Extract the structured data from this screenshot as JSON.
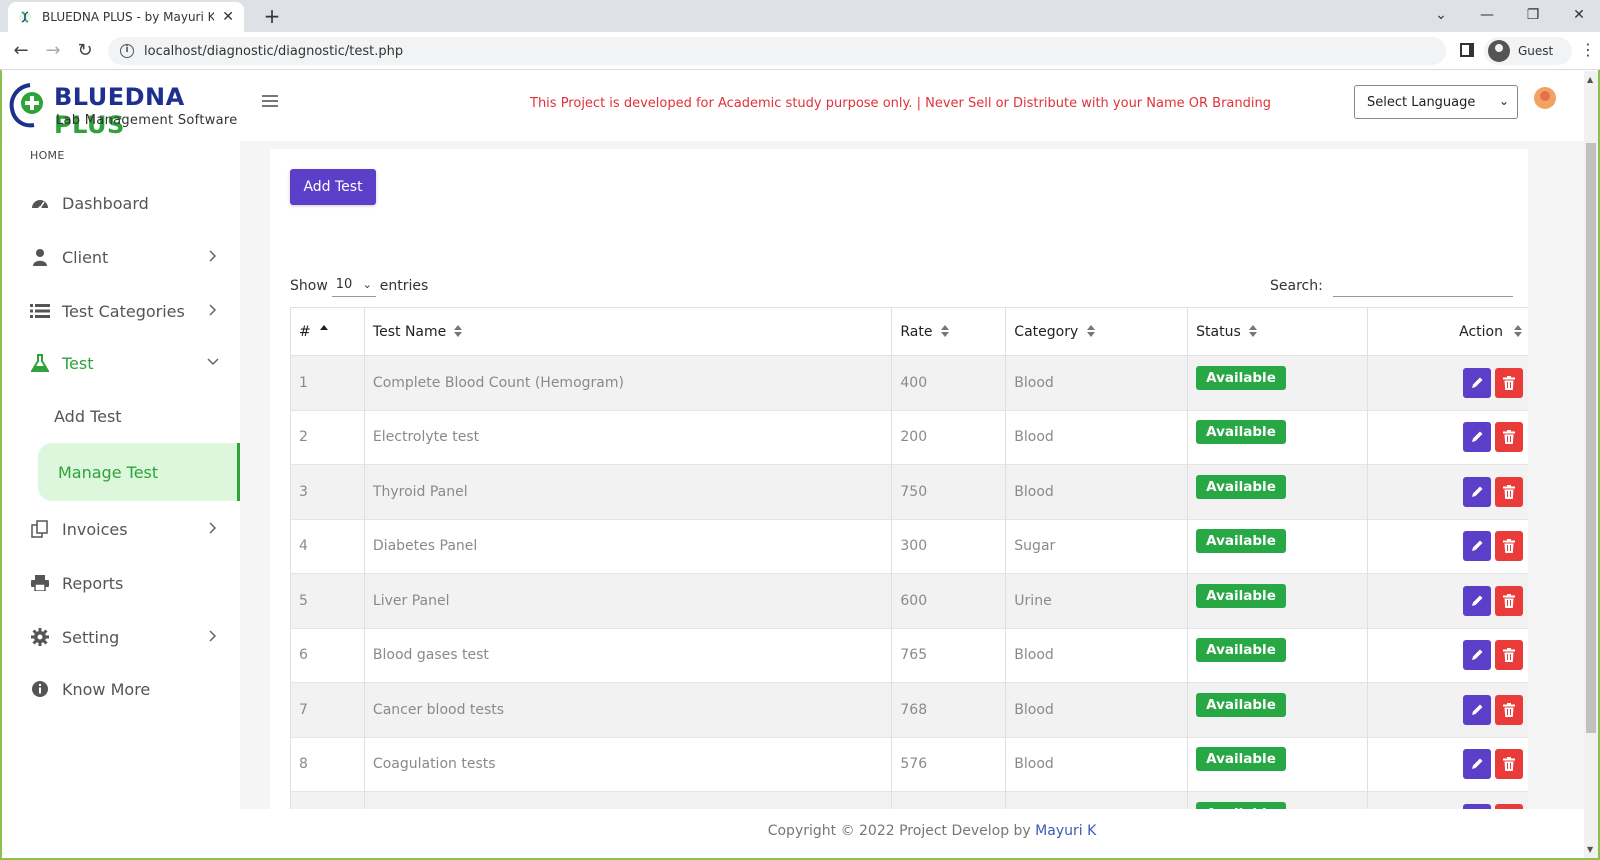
{
  "browser": {
    "tab_title": "BLUEDNA PLUS - by Mayuri K. Fr",
    "url": "localhost/diagnostic/diagnostic/test.php",
    "profile_label": "Guest"
  },
  "header": {
    "brand_main": "BLUEDNA",
    "brand_accent": "PLUS",
    "brand_sub": "Lab Management Software",
    "notice": "This Project is developed for Academic study purpose only. | Never Sell or Distribute with your Name OR Branding",
    "language_select": "Select Language"
  },
  "sidebar": {
    "home_label": "HOME",
    "items": [
      {
        "label": "Dashboard"
      },
      {
        "label": "Client"
      },
      {
        "label": "Test Categories"
      },
      {
        "label": "Test"
      },
      {
        "label": "Add Test"
      },
      {
        "label": "Manage Test"
      },
      {
        "label": "Invoices"
      },
      {
        "label": "Reports"
      },
      {
        "label": "Setting"
      },
      {
        "label": "Know More"
      }
    ]
  },
  "main": {
    "add_button": "Add Test",
    "show_label": "Show",
    "entries_value": "10",
    "entries_label": "entries",
    "search_label": "Search:",
    "columns": [
      "#",
      "Test Name",
      "Rate",
      "Category",
      "Status",
      "Action"
    ],
    "rows": [
      {
        "num": "1",
        "name": "Complete Blood Count (Hemogram)",
        "rate": "400",
        "category": "Blood",
        "status": "Available"
      },
      {
        "num": "2",
        "name": "Electrolyte test",
        "rate": "200",
        "category": "Blood",
        "status": "Available"
      },
      {
        "num": "3",
        "name": "Thyroid Panel",
        "rate": "750",
        "category": "Blood",
        "status": "Available"
      },
      {
        "num": "4",
        "name": "Diabetes Panel",
        "rate": "300",
        "category": "Sugar",
        "status": "Available"
      },
      {
        "num": "5",
        "name": "Liver Panel",
        "rate": "600",
        "category": "Urine",
        "status": "Available"
      },
      {
        "num": "6",
        "name": "Blood gases test",
        "rate": "765",
        "category": "Blood",
        "status": "Available"
      },
      {
        "num": "7",
        "name": "Cancer blood tests",
        "rate": "768",
        "category": "Blood",
        "status": "Available"
      },
      {
        "num": "8",
        "name": "Coagulation tests",
        "rate": "576",
        "category": "Blood",
        "status": "Available"
      },
      {
        "num": "",
        "name": "",
        "rate": "",
        "category": "",
        "status": "Available"
      }
    ]
  },
  "footer": {
    "text": "Copyright © 2022 Project Develop by",
    "author": "Mayuri K"
  },
  "colors": {
    "accent_purple": "#5b3fc8",
    "green": "#2fa33a",
    "danger": "#ea3b3b",
    "notice_red": "#e0323a",
    "brand_blue": "#1d2f8f"
  }
}
